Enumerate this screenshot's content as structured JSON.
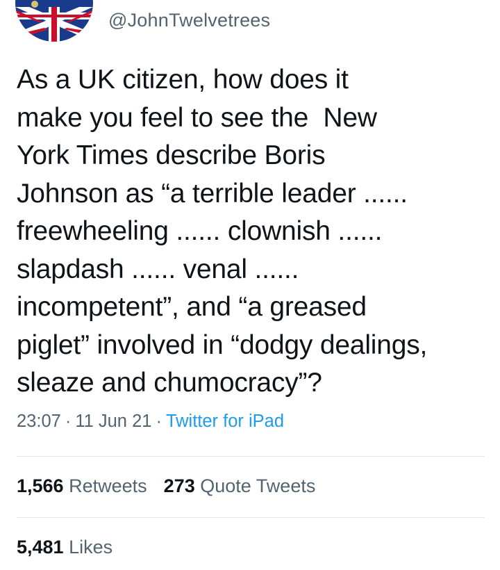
{
  "author": {
    "handle": "@JohnTwelvetrees",
    "avatar_icon": "union-jack-flag-avatar",
    "avatar_colors": {
      "blue": "#1a3a8c",
      "red": "#c8102e",
      "white": "#ffffff"
    }
  },
  "tweet": {
    "lines": [
      "As a UK citizen, how does it",
      "make you feel to see the  New",
      "York Times describe Boris",
      "Johnson as “a terrible leader ......",
      "freewheeling ...... clownish ......",
      "slapdash ...... venal ......",
      "incompetent”, and “a greased",
      "piglet” involved in “dodgy dealings,",
      "sleaze and chumocracy”?"
    ],
    "time": "23:07",
    "date": "11 Jun 21",
    "separator": "·",
    "source": "Twitter for iPad"
  },
  "stats": {
    "retweets_count": "1,566",
    "retweets_label": "Retweets",
    "quotes_count": "273",
    "quotes_label": "Quote Tweets",
    "likes_count": "5,481",
    "likes_label": "Likes"
  },
  "colors": {
    "text": "#0f1419",
    "secondary": "#536471",
    "link": "#1d9bf0",
    "divider": "#e1e8ed"
  }
}
